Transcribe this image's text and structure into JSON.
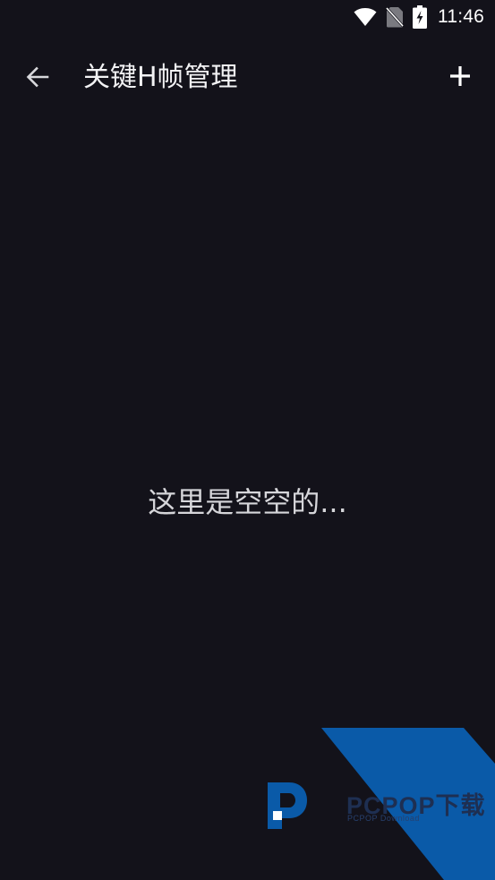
{
  "status_bar": {
    "time": "11:46",
    "icons": [
      "wifi-icon",
      "no-sim-icon",
      "battery-charging-icon"
    ]
  },
  "app_bar": {
    "title": "关键H帧管理",
    "back_icon": "arrow-left-icon",
    "add_icon": "plus-icon"
  },
  "empty_state": {
    "message": "这里是空空的..."
  },
  "watermark": {
    "brand": "PCPOP下载",
    "sub": "PCPOP Download"
  },
  "colors": {
    "background": "#13121a",
    "text": "#f2f2f4",
    "watermark_blue": "#0a5aa8"
  }
}
